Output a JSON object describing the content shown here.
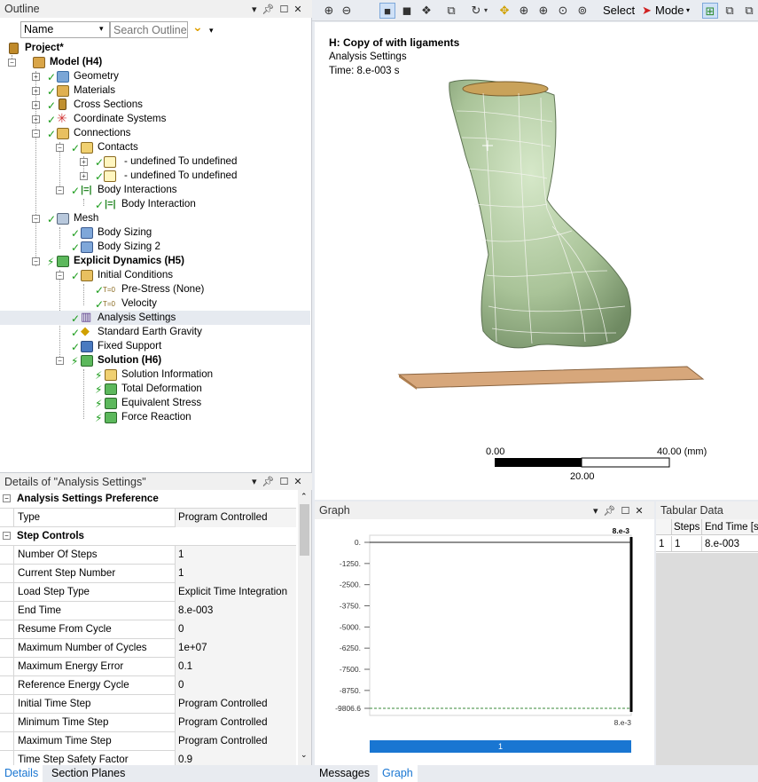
{
  "outline": {
    "title": "Outline",
    "name_filter": "Name",
    "search_placeholder": "Search Outline",
    "nodes": {
      "project": "Project*",
      "model": "Model (H4)",
      "geometry": "Geometry",
      "materials": "Materials",
      "cross_sections": "Cross Sections",
      "coordinate_systems": "Coordinate Systems",
      "connections": "Connections",
      "contacts": "Contacts",
      "contact1": "- undefined To undefined",
      "contact2": "- undefined To undefined",
      "body_interactions": "Body Interactions",
      "body_interaction": "Body Interaction",
      "mesh": "Mesh",
      "body_sizing": "Body Sizing",
      "body_sizing2": "Body Sizing 2",
      "explicit_dynamics": "Explicit Dynamics (H5)",
      "initial_conditions": "Initial Conditions",
      "pre_stress": "Pre-Stress (None)",
      "velocity": "Velocity",
      "analysis_settings": "Analysis Settings",
      "gravity": "Standard Earth Gravity",
      "fixed_support": "Fixed Support",
      "solution": "Solution (H6)",
      "solution_info": "Solution Information",
      "total_deformation": "Total Deformation",
      "equivalent_stress": "Equivalent Stress",
      "force_reaction": "Force Reaction"
    }
  },
  "details": {
    "title": "Details of \"Analysis Settings\"",
    "section1": "Analysis Settings Preference",
    "section2": "Step Controls",
    "rows1": [
      {
        "k": "Type",
        "v": "Program Controlled"
      }
    ],
    "rows2": [
      {
        "k": "Number Of Steps",
        "v": "1"
      },
      {
        "k": "Current Step Number",
        "v": "1"
      },
      {
        "k": "Load Step Type",
        "v": "Explicit Time Integration"
      },
      {
        "k": "End Time",
        "v": "8.e-003"
      },
      {
        "k": "Resume From Cycle",
        "v": "0"
      },
      {
        "k": "Maximum Number of Cycles",
        "v": "1e+07"
      },
      {
        "k": "Maximum Energy Error",
        "v": "0.1"
      },
      {
        "k": "Reference Energy Cycle",
        "v": "0"
      },
      {
        "k": "Initial Time Step",
        "v": "Program Controlled"
      },
      {
        "k": "Minimum Time Step",
        "v": "Program Controlled"
      },
      {
        "k": "Maximum Time Step",
        "v": "Program Controlled"
      },
      {
        "k": "Time Step Safety Factor",
        "v": "0.9"
      }
    ],
    "tabs": [
      "Details",
      "Section Planes"
    ]
  },
  "toolbar": {
    "select_label": "Select",
    "mode_label": "Mode"
  },
  "viewport": {
    "title": "H: Copy of with ligaments",
    "subtitle": "Analysis Settings",
    "time": "Time: 8.e-003 s",
    "scale_left": "0.00",
    "scale_right": "40.00 (mm)",
    "scale_mid": "20.00"
  },
  "graph": {
    "title": "Graph",
    "top_label": "8.e-3",
    "bottom_label": "8.e-3",
    "y_ticks": [
      "0.",
      "-1250.",
      "-2500.",
      "-3750.",
      "-5000.",
      "-6250.",
      "-7500.",
      "-8750.",
      "-9806.6"
    ],
    "bar_label": "1",
    "tabs": [
      "Messages",
      "Graph"
    ]
  },
  "tabular": {
    "title": "Tabular Data",
    "headers": [
      "Steps",
      "End Time [s]"
    ],
    "rows": [
      [
        "1",
        "1",
        "8.e-003"
      ]
    ]
  },
  "colors": {
    "accent": "#1976d2",
    "model_green": "#b5cfa5",
    "plate": "#d7a77b"
  },
  "chart_data": {
    "type": "line",
    "x": [
      0,
      0.008
    ],
    "y": [
      0,
      0
    ],
    "ylim": [
      -9806.6,
      0
    ],
    "y_ticks": [
      "0.",
      "-1250.",
      "-2500.",
      "-3750.",
      "-5000.",
      "-6250.",
      "-7500.",
      "-8750.",
      "-9806.6"
    ],
    "xlabel": "",
    "ylabel": ""
  }
}
